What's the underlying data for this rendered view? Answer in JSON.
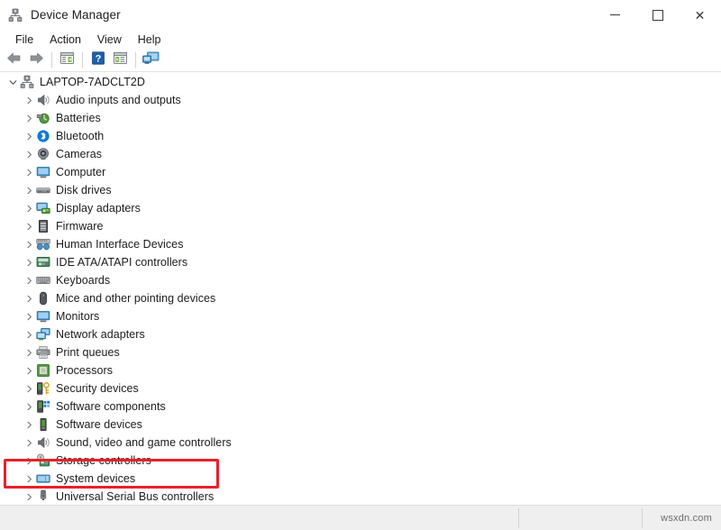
{
  "window": {
    "title": "Device Manager",
    "icon": "device-manager-icon",
    "controls": {
      "minimize": "—",
      "maximize": "☐",
      "close": "✕"
    }
  },
  "menubar": {
    "items": [
      {
        "label": "File"
      },
      {
        "label": "Action"
      },
      {
        "label": "View"
      },
      {
        "label": "Help"
      }
    ]
  },
  "toolbar": {
    "buttons": [
      {
        "name": "back-arrow-icon",
        "tooltip": "Back"
      },
      {
        "name": "forward-arrow-icon",
        "tooltip": "Forward"
      },
      {
        "name": "separator-1"
      },
      {
        "name": "properties-icon",
        "tooltip": "Properties"
      },
      {
        "name": "separator-2"
      },
      {
        "name": "help-icon",
        "tooltip": "Help"
      },
      {
        "name": "update-driver-icon",
        "tooltip": "Update Driver Software"
      },
      {
        "name": "separator-3"
      },
      {
        "name": "scan-hardware-changes-icon",
        "tooltip": "Scan for hardware changes"
      }
    ]
  },
  "tree": {
    "root": {
      "label": "LAPTOP-7ADCLT2D",
      "expanded": true,
      "icon": "computer-node-icon"
    },
    "items": [
      {
        "label": "Audio inputs and outputs",
        "icon": "speaker-icon",
        "expanded": false
      },
      {
        "label": "Batteries",
        "icon": "battery-icon",
        "expanded": false
      },
      {
        "label": "Bluetooth",
        "icon": "bluetooth-icon",
        "expanded": false
      },
      {
        "label": "Cameras",
        "icon": "camera-icon",
        "expanded": false
      },
      {
        "label": "Computer",
        "icon": "computer-icon",
        "expanded": false
      },
      {
        "label": "Disk drives",
        "icon": "disk-drive-icon",
        "expanded": false
      },
      {
        "label": "Display adapters",
        "icon": "display-adapter-icon",
        "expanded": false
      },
      {
        "label": "Firmware",
        "icon": "firmware-icon",
        "expanded": false
      },
      {
        "label": "Human Interface Devices",
        "icon": "hid-icon",
        "expanded": false
      },
      {
        "label": "IDE ATA/ATAPI controllers",
        "icon": "ide-controller-icon",
        "expanded": false
      },
      {
        "label": "Keyboards",
        "icon": "keyboard-icon",
        "expanded": false
      },
      {
        "label": "Mice and other pointing devices",
        "icon": "mouse-icon",
        "expanded": false
      },
      {
        "label": "Monitors",
        "icon": "monitor-icon",
        "expanded": false
      },
      {
        "label": "Network adapters",
        "icon": "network-adapter-icon",
        "expanded": false
      },
      {
        "label": "Print queues",
        "icon": "printer-icon",
        "expanded": false
      },
      {
        "label": "Processors",
        "icon": "processor-icon",
        "expanded": false
      },
      {
        "label": "Security devices",
        "icon": "security-device-icon",
        "expanded": false
      },
      {
        "label": "Software components",
        "icon": "software-component-icon",
        "expanded": false
      },
      {
        "label": "Software devices",
        "icon": "software-device-icon",
        "expanded": false
      },
      {
        "label": "Sound, video and game controllers",
        "icon": "sound-controller-icon",
        "expanded": false
      },
      {
        "label": "Storage controllers",
        "icon": "storage-controller-icon",
        "expanded": false
      },
      {
        "label": "System devices",
        "icon": "system-device-icon",
        "expanded": false
      },
      {
        "label": "Universal Serial Bus controllers",
        "icon": "usb-icon",
        "expanded": false,
        "highlighted": true
      }
    ]
  },
  "annotation": {
    "type": "red-rectangle-highlight",
    "target": "Universal Serial Bus controllers",
    "color": "#e8212a"
  },
  "statusbar": {
    "pane1": "",
    "pane2": "",
    "watermark": "wsxdn.com"
  }
}
